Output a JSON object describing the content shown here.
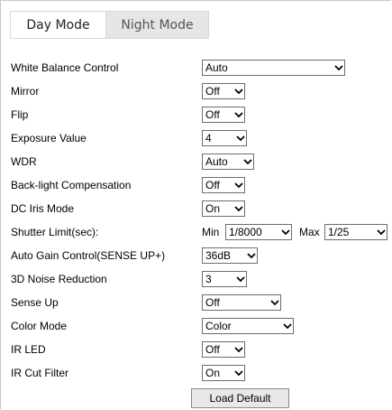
{
  "tabs": [
    {
      "label": "Day Mode",
      "active": true
    },
    {
      "label": "Night Mode",
      "active": false
    }
  ],
  "settings": [
    {
      "label": "White Balance Control",
      "value": "Auto"
    },
    {
      "label": "Mirror",
      "value": "Off"
    },
    {
      "label": "Flip",
      "value": "Off"
    },
    {
      "label": "Exposure Value",
      "value": "4"
    },
    {
      "label": "WDR",
      "value": "Auto"
    },
    {
      "label": "Back-light Compensation",
      "value": "Off"
    },
    {
      "label": "DC Iris Mode",
      "value": "On"
    },
    {
      "label": "Shutter Limit(sec):",
      "min_label": "Min",
      "min_value": "1/8000",
      "max_label": "Max",
      "max_value": "1/25"
    },
    {
      "label": "Auto Gain Control(SENSE UP+)",
      "value": "36dB"
    },
    {
      "label": "3D Noise Reduction",
      "value": "3"
    },
    {
      "label": "Sense Up",
      "value": "Off"
    },
    {
      "label": "Color Mode",
      "value": "Color"
    },
    {
      "label": "IR LED",
      "value": "Off"
    },
    {
      "label": "IR Cut Filter",
      "value": "On"
    }
  ],
  "load_default_label": "Load Default",
  "chevron_icon": "chevron-down-icon"
}
